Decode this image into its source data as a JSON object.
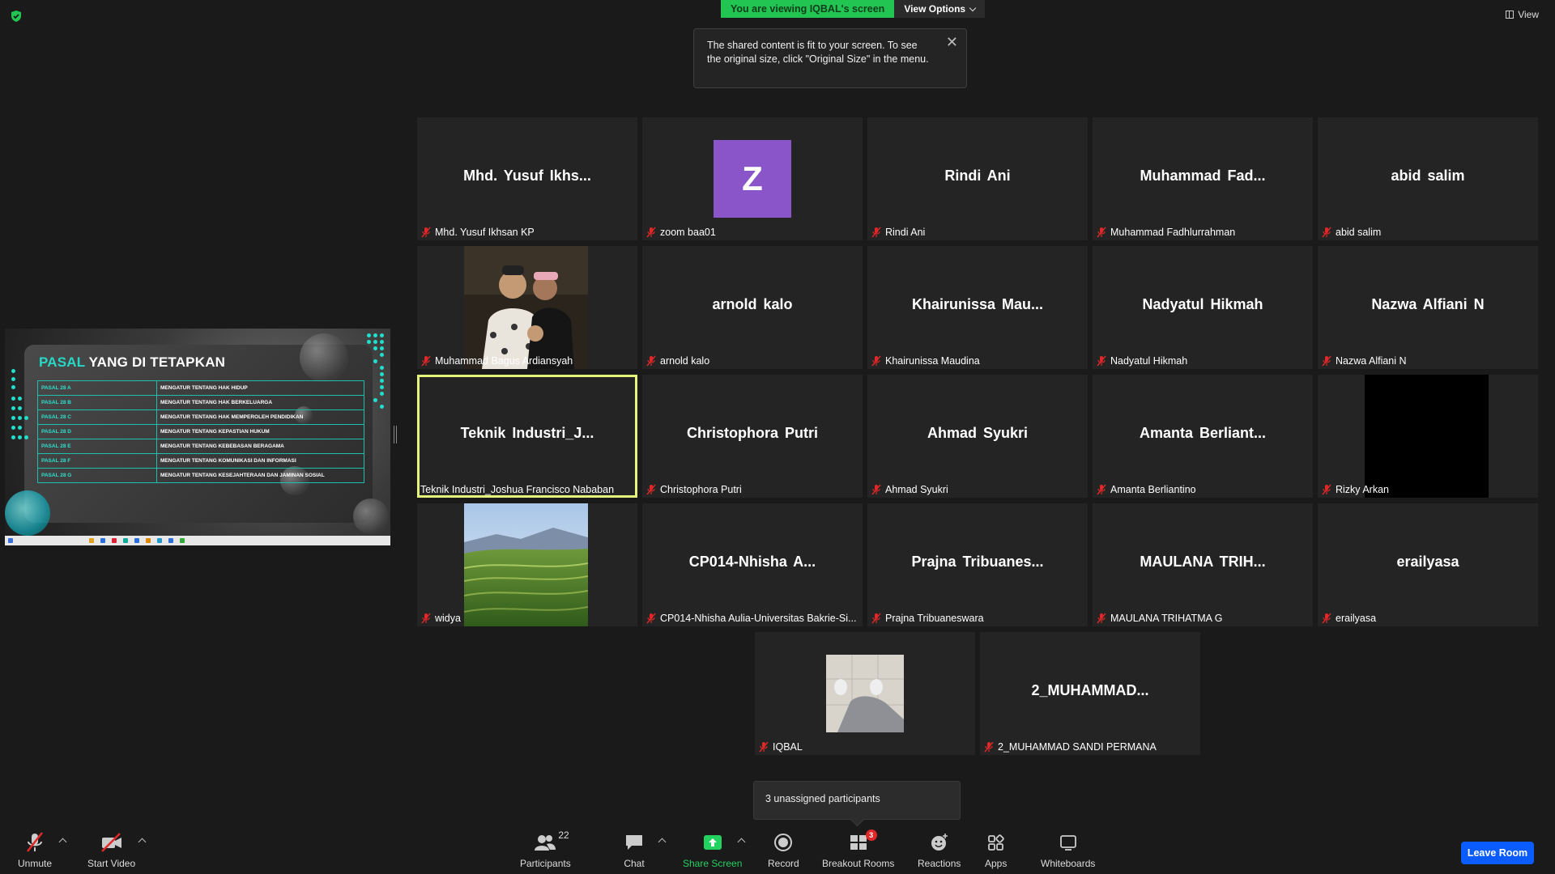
{
  "header": {
    "viewing_text": "You are viewing IQBAL's screen",
    "view_options_label": "View Options",
    "view_label": "View"
  },
  "tooltip": {
    "text": "The shared content is fit to your screen. To see the original size, click \"Original Size\" in the menu."
  },
  "shared_slide": {
    "title_highlight": "PASAL",
    "title_rest": " YANG DI TETAPKAN",
    "rows": [
      {
        "pasal": "PASAL 28 A",
        "desc": "MENGATUR TENTANG HAK HIDUP"
      },
      {
        "pasal": "PASAL 28 B",
        "desc": "MENGATUR TENTANG HAK BERKELUARGA"
      },
      {
        "pasal": "PASAL 28 C",
        "desc": "MENGATUR TENTANG HAK MEMPEROLEH PENDIDIKAN"
      },
      {
        "pasal": "PASAL 28 D",
        "desc": "MENGATUR TENTANG KEPASTIAN HUKUM"
      },
      {
        "pasal": "PASAL 28 E",
        "desc": "MENGATUR TENTANG KEBEBASAN BERAGAMA"
      },
      {
        "pasal": "PASAL 28 F",
        "desc": "MENGATUR TENTANG KOMUNIKASI DAN INFORMASI"
      },
      {
        "pasal": "PASAL 28 G",
        "desc": "MENGATUR TENTANG KESEJAHTERAAN DAN JAMINAN SOSIAL"
      }
    ]
  },
  "participants_grid": [
    {
      "display": "Mhd. Yusuf Ikhs...",
      "label": "Mhd. Yusuf Ikhsan KP",
      "muted": true,
      "video": "none"
    },
    {
      "display": "Z",
      "label": "zoom baa01",
      "muted": true,
      "video": "avatar-z"
    },
    {
      "display": "Rindi Ani",
      "label": "Rindi Ani",
      "muted": true,
      "video": "none"
    },
    {
      "display": "Muhammad Fad...",
      "label": "Muhammad Fadhlurrahman",
      "muted": true,
      "video": "none"
    },
    {
      "display": "abid salim",
      "label": "abid salim",
      "muted": true,
      "video": "none"
    },
    {
      "display": "",
      "label": "Muhammad Bagus Ardiansyah",
      "muted": true,
      "video": "photo-people"
    },
    {
      "display": "arnold kalo",
      "label": "arnold kalo",
      "muted": true,
      "video": "none"
    },
    {
      "display": "Khairunissa Mau...",
      "label": "Khairunissa Maudina",
      "muted": true,
      "video": "none"
    },
    {
      "display": "Nadyatul Hikmah",
      "label": "Nadyatul Hikmah",
      "muted": true,
      "video": "none"
    },
    {
      "display": "Nazwa Alfiani N",
      "label": "Nazwa Alfiani N",
      "muted": true,
      "video": "none"
    },
    {
      "display": "Teknik Industri_J...",
      "label": "Teknik Industri_Joshua Francisco Nababan",
      "muted": false,
      "video": "none",
      "active": true
    },
    {
      "display": "Christophora Putri",
      "label": "Christophora Putri",
      "muted": true,
      "video": "none"
    },
    {
      "display": "Ahmad Syukri",
      "label": "Ahmad Syukri",
      "muted": true,
      "video": "none"
    },
    {
      "display": "Amanta Berliant...",
      "label": "Amanta Berliantino",
      "muted": true,
      "video": "none"
    },
    {
      "display": "",
      "label": "Rizky Arkan",
      "muted": true,
      "video": "black"
    },
    {
      "display": "",
      "label": "widya",
      "muted": true,
      "video": "photo-landscape"
    },
    {
      "display": "CP014-Nhisha A...",
      "label": "CP014-Nhisha Aulia-Universitas Bakrie-Si...",
      "muted": true,
      "video": "none"
    },
    {
      "display": "Prajna Tribuanes...",
      "label": "Prajna Tribuaneswara",
      "muted": true,
      "video": "none"
    },
    {
      "display": "MAULANA TRIH...",
      "label": "MAULANA TRIHATMA G",
      "muted": true,
      "video": "none"
    },
    {
      "display": "erailyasa",
      "label": "erailyasa",
      "muted": true,
      "video": "none"
    },
    {
      "display": "",
      "label": "IQBAL",
      "muted": true,
      "video": "photo-feet"
    },
    {
      "display": "2_MUHAMMAD...",
      "label": "2_MUHAMMAD SANDI PERMANA",
      "muted": true,
      "video": "none"
    }
  ],
  "unassigned_popup": "3 unassigned participants",
  "toolbar": {
    "unmute": "Unmute",
    "start_video": "Start Video",
    "participants": "Participants",
    "participants_count": "22",
    "chat": "Chat",
    "share_screen": "Share Screen",
    "record": "Record",
    "breakout_rooms": "Breakout Rooms",
    "breakout_badge": "3",
    "reactions": "Reactions",
    "apps": "Apps",
    "whiteboards": "Whiteboards",
    "leave_room": "Leave Room"
  },
  "colors": {
    "background": "#1a1a1a",
    "tile": "#242424",
    "accent_green": "#23c552",
    "leave_blue": "#0b5cff",
    "active_speaker": "#e4f37a",
    "muted_red": "#e02828",
    "slide_teal": "#25d9c6"
  }
}
